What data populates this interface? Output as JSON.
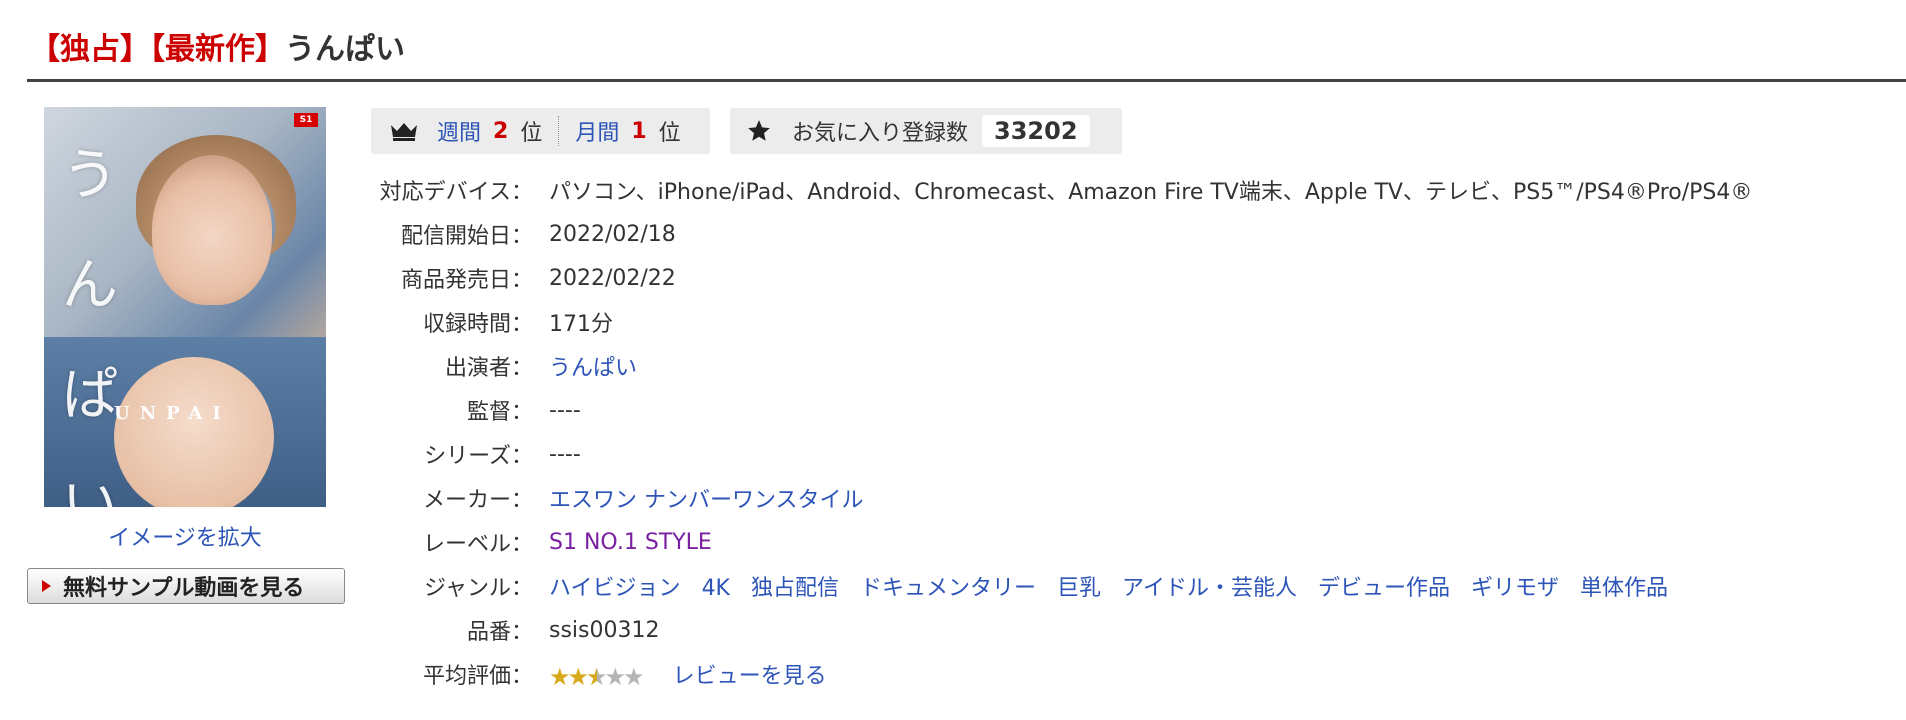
{
  "title": {
    "tag1": "【独占】",
    "tag2": "【最新作】",
    "name": "うんぱい"
  },
  "cover": {
    "vertical_text": "うんぱい",
    "horizontal_text": "UNPAI",
    "logo": "S1"
  },
  "enlarge_link": "イメージを拡大",
  "sample_button": "無料サンプル動画を見る",
  "ranking": {
    "weekly_label": "週間",
    "weekly_rank": "2",
    "rank_suffix": "位",
    "monthly_label": "月間",
    "monthly_rank": "1"
  },
  "favorites": {
    "label": "お気に入り登録数",
    "count": "33202"
  },
  "details": {
    "sep": "：",
    "devices_key": "対応デバイス",
    "devices_val": "パソコン、iPhone/iPad、Android、Chromecast、Amazon Fire TV端末、Apple TV、テレビ、PS5™/PS4®Pro/PS4®",
    "start_key": "配信開始日",
    "start_val": "2022/02/18",
    "release_key": "商品発売日",
    "release_val": "2022/02/22",
    "duration_key": "収録時間",
    "duration_val": "171分",
    "performer_key": "出演者",
    "performer_val": "うんぱい",
    "director_key": "監督",
    "director_val": "----",
    "series_key": "シリーズ",
    "series_val": "----",
    "maker_key": "メーカー",
    "maker_val": "エスワン ナンバーワンスタイル",
    "label_key": "レーベル",
    "label_val": "S1 NO.1 STYLE",
    "genre_key": "ジャンル",
    "genres": [
      "ハイビジョン",
      "4K",
      "独占配信",
      "ドキュメンタリー",
      "巨乳",
      "アイドル・芸能人",
      "デビュー作品",
      "ギリモザ",
      "単体作品"
    ],
    "code_key": "品番",
    "code_val": "ssis00312",
    "rating_key": "平均評価",
    "rating_value": 2.5,
    "review_link": "レビューを見る"
  },
  "colors": {
    "accent_red": "#cc0000",
    "link_blue": "#2d55b8",
    "label_purple": "#7a1fa2",
    "star_gold": "#d9a91c"
  }
}
